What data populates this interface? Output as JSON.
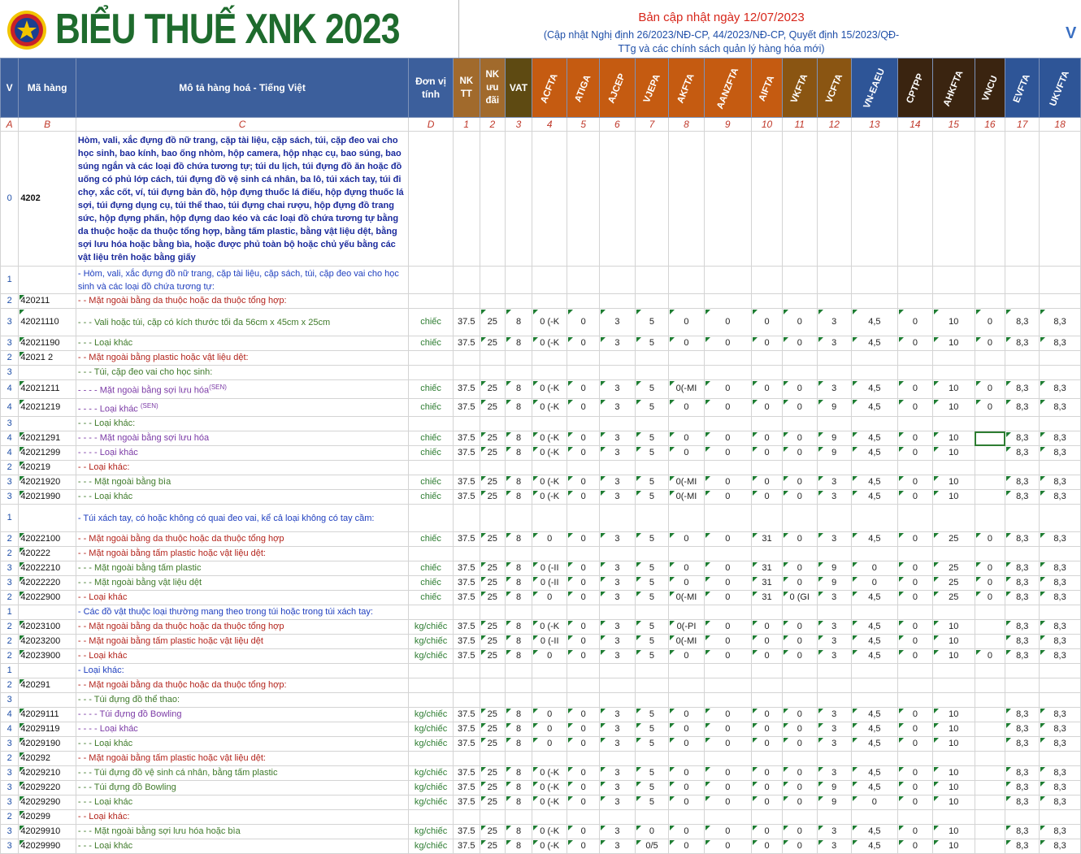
{
  "banner": {
    "title": "BIỂU THUẾ XNK 2023",
    "update_date": "Bản cập nhật ngày 12/07/2023",
    "update_note": "(Cập nhật Nghị định 26/2023/NĐ-CP, 44/2023/NĐ-CP, Quyết định 15/2023/QĐ-TTg và các chính sách quản lý hàng hóa mới)",
    "edge_mark": "V",
    "logo_icon": "customs-emblem-icon"
  },
  "headers": [
    "V",
    "Mã hàng",
    "Mô tả hàng hoá - Tiếng Việt",
    "Đơn vị tính",
    "NK TT",
    "NK ưu đãi",
    "VAT",
    "ACFTA",
    "ATIGA",
    "AJCEP",
    "VJEPA",
    "AKFTA",
    "AANZFTA",
    "AIFTA",
    "VKFTA",
    "VCFTA",
    "VN-EAEU",
    "CPTPP",
    "AHKFTA",
    "VNCU",
    "EVFTA",
    "UKVFTA"
  ],
  "letters": [
    "A",
    "B",
    "C",
    "D",
    "1",
    "2",
    "3",
    "4",
    "5",
    "6",
    "7",
    "8",
    "9",
    "10",
    "11",
    "12",
    "13",
    "14",
    "15",
    "16",
    "17",
    "18"
  ],
  "rows": [
    {
      "v": "0",
      "code": "4202",
      "desc": "Hòm, vali, xắc đựng đồ nữ trang, cặp tài liệu, cặp sách, túi, cặp đeo vai cho học sinh, bao kính, bao ống nhòm, hộp camera, hộp nhạc cụ, bao súng, bao súng ngắn và các loại đồ chứa tương tự; túi du lịch, túi đựng đồ ăn hoặc đồ uống có phủ lớp cách, túi đựng đồ vệ sinh cá nhân, ba lô, túi xách tay, túi đi chợ, xắc cốt, ví, túi đựng bản đồ, hộp đựng thuốc lá điếu, hộp đựng thuốc lá sợi, túi đựng dụng cụ, túi thể thao, túi đựng chai rượu, hộp đựng đồ trang sức, hộp đựng phấn, hộp đựng dao kéo và các loại đồ chứa tương tự bằng da thuộc hoặc da thuộc tổng hợp, bằng tấm plastic, bằng vật liệu dệt, bằng sợi lưu hóa hoặc bằng bìa, hoặc được phủ toàn bộ hoặc chủ yếu bằng các vật liệu trên hoặc bằng giấy",
      "style": "bold",
      "h": 166,
      "unit": "",
      "rates": []
    },
    {
      "v": "1",
      "code": "",
      "desc": "- Hòm, vali, xắc đựng đồ nữ trang, cặp tài liệu, cặp sách, túi, cặp đeo vai cho học sinh và các loại đồ chứa tương tự:",
      "style": "blue",
      "h": 34,
      "unit": "",
      "rates": []
    },
    {
      "v": "2",
      "code": "420211",
      "desc": "- - Mặt ngoài bằng da thuộc hoặc da thuộc tổng hợp:",
      "style": "red",
      "h": 18,
      "unit": "",
      "rates": []
    },
    {
      "v": "3",
      "code": "42021110",
      "desc": "- - - Vali hoặc túi, cặp có kích thước tối đa 56cm x 45cm x 25cm",
      "style": "green",
      "h": 34,
      "unit": "chiếc",
      "rates": [
        "37.5",
        "25",
        "8",
        "0 (-K",
        "0",
        "3",
        "5",
        "0",
        "0",
        "0",
        "0",
        "3",
        "4,5",
        "0",
        "10",
        "0",
        "8,3",
        "8,3"
      ]
    },
    {
      "v": "3",
      "code": "42021190",
      "desc": "- - - Loại khác",
      "style": "green",
      "h": 18,
      "unit": "chiếc",
      "rates": [
        "37.5",
        "25",
        "8",
        "0 (-K",
        "0",
        "3",
        "5",
        "0",
        "0",
        "0",
        "0",
        "3",
        "4,5",
        "0",
        "10",
        "0",
        "8,3",
        "8,3"
      ]
    },
    {
      "v": "2",
      "code": "42021 2",
      "desc": "- - Mặt ngoài bằng plastic hoặc vật liệu dệt:",
      "style": "red",
      "h": 18,
      "unit": "",
      "rates": []
    },
    {
      "v": "3",
      "code": "",
      "desc": "- - - Túi, cặp đeo vai cho học sinh:",
      "style": "green",
      "h": 18,
      "unit": "",
      "rates": []
    },
    {
      "v": "4",
      "code": "42021211",
      "desc": "- - - - Mặt ngoài bằng sợi lưu hóa",
      "sup": "(SEN)",
      "style": "purple",
      "h": 22,
      "unit": "chiếc",
      "rates": [
        "37.5",
        "25",
        "8",
        "0 (-K",
        "0",
        "3",
        "5",
        "0(-MI",
        "0",
        "0",
        "0",
        "3",
        "4,5",
        "0",
        "10",
        "0",
        "8,3",
        "8,3"
      ]
    },
    {
      "v": "4",
      "code": "42021219",
      "desc": "- - - - Loại khác ",
      "sup": "(SEN)",
      "style": "purple",
      "h": 18,
      "unit": "chiếc",
      "rates": [
        "37.5",
        "25",
        "8",
        "0 (-K",
        "0",
        "3",
        "5",
        "0",
        "0",
        "0",
        "0",
        "9",
        "4,5",
        "0",
        "10",
        "0",
        "8,3",
        "8,3"
      ]
    },
    {
      "v": "3",
      "code": "",
      "desc": "- - - Loại khác:",
      "style": "green",
      "h": 18,
      "unit": "",
      "rates": []
    },
    {
      "v": "4",
      "code": "42021291",
      "desc": "- - - - Mặt ngoài bằng sợi lưu hóa",
      "style": "purple",
      "h": 18,
      "unit": "chiếc",
      "rates": [
        "37.5",
        "25",
        "8",
        "0 (-K",
        "0",
        "3",
        "5",
        "0",
        "0",
        "0",
        "0",
        "9",
        "4,5",
        "0",
        "10",
        "",
        "8,3",
        "8,3"
      ]
    },
    {
      "v": "4",
      "code": "42021299",
      "desc": "- - - - Loại khác",
      "style": "purple",
      "h": 18,
      "unit": "chiếc",
      "rates": [
        "37.5",
        "25",
        "8",
        "0 (-K",
        "0",
        "3",
        "5",
        "0",
        "0",
        "0",
        "0",
        "9",
        "4,5",
        "0",
        "10",
        "",
        "8,3",
        "8,3"
      ]
    },
    {
      "v": "2",
      "code": "420219",
      "desc": "- - Loại khác:",
      "style": "red",
      "h": 18,
      "unit": "",
      "rates": []
    },
    {
      "v": "3",
      "code": "42021920",
      "desc": "- - - Mặt ngoài bằng bìa",
      "style": "green",
      "h": 18,
      "unit": "chiếc",
      "rates": [
        "37.5",
        "25",
        "8",
        "0 (-K",
        "0",
        "3",
        "5",
        "0(-MI",
        "0",
        "0",
        "0",
        "3",
        "4,5",
        "0",
        "10",
        "",
        "8,3",
        "8,3"
      ]
    },
    {
      "v": "3",
      "code": "42021990",
      "desc": "- - - Loại khác",
      "style": "green",
      "h": 18,
      "unit": "chiếc",
      "rates": [
        "37.5",
        "25",
        "8",
        "0 (-K",
        "0",
        "3",
        "5",
        "0(-MI",
        "0",
        "0",
        "0",
        "3",
        "4,5",
        "0",
        "10",
        "",
        "8,3",
        "8,3"
      ]
    },
    {
      "v": "1",
      "code": "",
      "desc": "- Túi xách tay, có hoặc không có quai đeo vai, kể cả loại không có tay cầm:",
      "style": "blue",
      "h": 34,
      "unit": "",
      "rates": []
    },
    {
      "v": "2",
      "code": "42022100",
      "desc": "- - Mặt ngoài bằng da thuộc hoặc da thuộc tổng hợp",
      "style": "red",
      "h": 18,
      "unit": "chiếc",
      "rates": [
        "37.5",
        "25",
        "8",
        "0",
        "0",
        "3",
        "5",
        "0",
        "0",
        "31",
        "0",
        "3",
        "4,5",
        "0",
        "25",
        "0",
        "8,3",
        "8,3"
      ]
    },
    {
      "v": "2",
      "code": "420222",
      "desc": "- - Mặt ngoài bằng tấm plastic hoặc vật liệu dệt:",
      "style": "red",
      "h": 18,
      "unit": "",
      "rates": []
    },
    {
      "v": "3",
      "code": "42022210",
      "desc": "- - - Mặt ngoài bằng tấm plastic",
      "style": "green",
      "h": 18,
      "unit": "chiếc",
      "rates": [
        "37.5",
        "25",
        "8",
        "0 (-II",
        "0",
        "3",
        "5",
        "0",
        "0",
        "31",
        "0",
        "9",
        "0",
        "0",
        "25",
        "0",
        "8,3",
        "8,3"
      ]
    },
    {
      "v": "3",
      "code": "42022220",
      "desc": "- - - Mặt ngoài bằng vật liệu dệt",
      "style": "green",
      "h": 18,
      "unit": "chiếc",
      "rates": [
        "37.5",
        "25",
        "8",
        "0 (-II",
        "0",
        "3",
        "5",
        "0",
        "0",
        "31",
        "0",
        "9",
        "0",
        "0",
        "25",
        "0",
        "8,3",
        "8,3"
      ]
    },
    {
      "v": "2",
      "code": "42022900",
      "desc": "- - Loại khác",
      "style": "red",
      "h": 18,
      "unit": "chiếc",
      "rates": [
        "37.5",
        "25",
        "8",
        "0",
        "0",
        "3",
        "5",
        "0(-MI",
        "0",
        "31",
        "0 (GI",
        "3",
        "4,5",
        "0",
        "25",
        "0",
        "8,3",
        "8,3"
      ]
    },
    {
      "v": "1",
      "code": "",
      "desc": "- Các đồ vật thuộc loại thường mang theo trong túi hoặc trong túi xách tay:",
      "style": "blue",
      "h": 18,
      "unit": "",
      "rates": []
    },
    {
      "v": "2",
      "code": "42023100",
      "desc": "- - Mặt ngoài bằng da thuộc hoặc da thuộc tổng hợp",
      "style": "red",
      "h": 18,
      "unit": "kg/chiếc",
      "rates": [
        "37.5",
        "25",
        "8",
        "0 (-K",
        "0",
        "3",
        "5",
        "0(-PI",
        "0",
        "0",
        "0",
        "3",
        "4,5",
        "0",
        "10",
        "",
        "8,3",
        "8,3"
      ]
    },
    {
      "v": "2",
      "code": "42023200",
      "desc": "- - Mặt ngoài bằng tấm plastic hoặc vật liệu dệt",
      "style": "red",
      "h": 18,
      "unit": "kg/chiếc",
      "rates": [
        "37.5",
        "25",
        "8",
        "0 (-II",
        "0",
        "3",
        "5",
        "0(-MI",
        "0",
        "0",
        "0",
        "3",
        "4,5",
        "0",
        "10",
        "",
        "8,3",
        "8,3"
      ]
    },
    {
      "v": "2",
      "code": "42023900",
      "desc": "- - Loại khác",
      "style": "red",
      "h": 18,
      "unit": "kg/chiếc",
      "rates": [
        "37.5",
        "25",
        "8",
        "0",
        "0",
        "3",
        "5",
        "0",
        "0",
        "0",
        "0",
        "3",
        "4,5",
        "0",
        "10",
        "0",
        "8,3",
        "8,3"
      ]
    },
    {
      "v": "1",
      "code": "",
      "desc": "- Loại khác:",
      "style": "blue",
      "h": 18,
      "unit": "",
      "rates": []
    },
    {
      "v": "2",
      "code": "420291",
      "desc": "- - Mặt ngoài bằng da thuộc hoặc da thuộc tổng hợp:",
      "style": "red",
      "h": 18,
      "unit": "",
      "rates": []
    },
    {
      "v": "3",
      "code": "",
      "desc": "- - - Túi đựng đồ thể thao:",
      "style": "green",
      "h": 18,
      "unit": "",
      "rates": []
    },
    {
      "v": "4",
      "code": "42029111",
      "desc": "- - - - Túi đựng đồ Bowling",
      "style": "purple",
      "h": 18,
      "unit": "kg/chiếc",
      "rates": [
        "37.5",
        "25",
        "8",
        "0",
        "0",
        "3",
        "5",
        "0",
        "0",
        "0",
        "0",
        "3",
        "4,5",
        "0",
        "10",
        "",
        "8,3",
        "8,3"
      ]
    },
    {
      "v": "4",
      "code": "42029119",
      "desc": "- - - - Loại khác",
      "style": "purple",
      "h": 18,
      "unit": "kg/chiếc",
      "rates": [
        "37.5",
        "25",
        "8",
        "0",
        "0",
        "3",
        "5",
        "0",
        "0",
        "0",
        "0",
        "3",
        "4,5",
        "0",
        "10",
        "",
        "8,3",
        "8,3"
      ]
    },
    {
      "v": "3",
      "code": "42029190",
      "desc": "- - - Loại khác",
      "style": "green",
      "h": 18,
      "unit": "kg/chiếc",
      "rates": [
        "37.5",
        "25",
        "8",
        "0",
        "0",
        "3",
        "5",
        "0",
        "0",
        "0",
        "0",
        "3",
        "4,5",
        "0",
        "10",
        "",
        "8,3",
        "8,3"
      ]
    },
    {
      "v": "2",
      "code": "420292",
      "desc": "- - Mặt ngoài bằng tấm plastic hoặc vật liệu dệt:",
      "style": "red",
      "h": 18,
      "unit": "",
      "rates": []
    },
    {
      "v": "3",
      "code": "42029210",
      "desc": "- - - Túi đựng đồ vệ sinh cá nhân, bằng tấm plastic",
      "style": "green",
      "h": 18,
      "unit": "kg/chiếc",
      "rates": [
        "37.5",
        "25",
        "8",
        "0 (-K",
        "0",
        "3",
        "5",
        "0",
        "0",
        "0",
        "0",
        "3",
        "4,5",
        "0",
        "10",
        "",
        "8,3",
        "8,3"
      ]
    },
    {
      "v": "3",
      "code": "42029220",
      "desc": "- - - Túi đựng đồ Bowling",
      "style": "green",
      "h": 18,
      "unit": "kg/chiếc",
      "rates": [
        "37.5",
        "25",
        "8",
        "0 (-K",
        "0",
        "3",
        "5",
        "0",
        "0",
        "0",
        "0",
        "9",
        "4,5",
        "0",
        "10",
        "",
        "8,3",
        "8,3"
      ]
    },
    {
      "v": "3",
      "code": "42029290",
      "desc": "- - - Loại khác",
      "style": "green",
      "h": 18,
      "unit": "kg/chiếc",
      "rates": [
        "37.5",
        "25",
        "8",
        "0 (-K",
        "0",
        "3",
        "5",
        "0",
        "0",
        "0",
        "0",
        "9",
        "0",
        "0",
        "10",
        "",
        "8,3",
        "8,3"
      ]
    },
    {
      "v": "2",
      "code": "420299",
      "desc": "- - Loại khác:",
      "style": "red",
      "h": 18,
      "unit": "",
      "rates": []
    },
    {
      "v": "3",
      "code": "42029910",
      "desc": "- - - Mặt ngoài bằng sợi lưu hóa hoặc bìa",
      "style": "green",
      "h": 18,
      "unit": "kg/chiếc",
      "rates": [
        "37.5",
        "25",
        "8",
        "0 (-K",
        "0",
        "3",
        "0",
        "0",
        "0",
        "0",
        "0",
        "3",
        "4,5",
        "0",
        "10",
        "",
        "8,3",
        "8,3"
      ]
    },
    {
      "v": "3",
      "code": "42029990",
      "desc": "- - - Loại khác",
      "style": "green",
      "h": 18,
      "unit": "kg/chiếc",
      "rates": [
        "37.5",
        "25",
        "8",
        "0 (-K",
        "0",
        "3",
        "0/5",
        "0",
        "0",
        "0",
        "0",
        "3",
        "4,5",
        "0",
        "10",
        "",
        "8,3",
        "8,3"
      ]
    }
  ]
}
